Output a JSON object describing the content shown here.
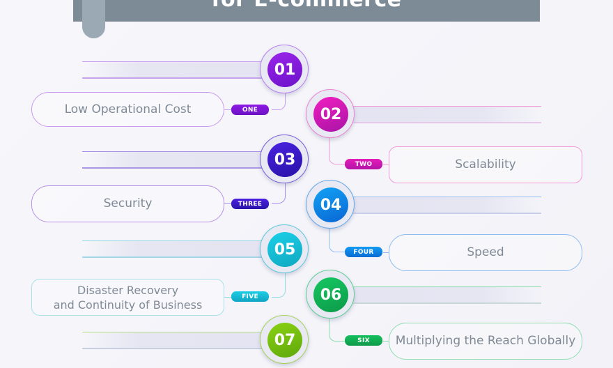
{
  "header": {
    "title": "for E-commerce"
  },
  "steps": [
    {
      "number": "01",
      "tag": "ONE",
      "label": "Low Operational Cost",
      "color": "#8a16e0",
      "color2": "#6b12c9",
      "line": "#c89af0"
    },
    {
      "number": "02",
      "tag": "TWO",
      "label": "Scalability",
      "color": "#e01bb5",
      "color2": "#b014a8",
      "line": "#f29ad8"
    },
    {
      "number": "03",
      "tag": "THREE",
      "label": "Security",
      "color": "#3f1ad6",
      "color2": "#2b14b0",
      "line": "#a78ee8"
    },
    {
      "number": "04",
      "tag": "FOUR",
      "label": "Speed",
      "color": "#0b8ff0",
      "color2": "#0a6fd8",
      "line": "#8fbcf0"
    },
    {
      "number": "05",
      "tag": "FIVE",
      "label_line1": "Disaster Recovery",
      "label_line2": "and Continuity of Business",
      "color": "#14c3d9",
      "color2": "#11a9c8",
      "line": "#93dbe6"
    },
    {
      "number": "06",
      "tag": "SIX",
      "label": "Multiplying the Reach Globally",
      "color": "#12b85a",
      "color2": "#0e9d4c",
      "line": "#8fdcb0"
    },
    {
      "number": "07",
      "color": "#7ec611",
      "color2": "#64ac0c",
      "line": "#b9dd84"
    }
  ]
}
